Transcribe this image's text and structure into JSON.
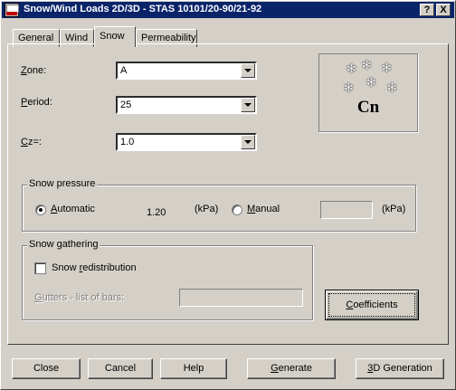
{
  "window": {
    "title": "Snow/Wind Loads 2D/3D - STAS 10101/20-90/21-92",
    "help_button": "?",
    "close_button": "X"
  },
  "tabs": [
    {
      "label": "General",
      "active": false
    },
    {
      "label": "Wind",
      "active": false
    },
    {
      "label": "Snow",
      "active": true
    },
    {
      "label": "Permeability",
      "active": false
    }
  ],
  "fields": {
    "zone": {
      "label_u": "Z",
      "label_rest": "one:",
      "value": "A"
    },
    "period": {
      "label_u": "P",
      "label_rest": "eriod:",
      "value": "25"
    },
    "cz": {
      "label_u": "C",
      "label_rest": "z=:",
      "value": "1.0"
    }
  },
  "cn_image": {
    "label": "Cn",
    "flake": "❄"
  },
  "snow_pressure": {
    "legend": "Snow pressure",
    "automatic_label_u": "A",
    "automatic_label_rest": "utomatic",
    "automatic_selected": true,
    "value": "1.20",
    "unit1": "(kPa)",
    "manual_label_u": "M",
    "manual_label_rest": "anual",
    "manual_selected": false,
    "manual_value": "",
    "unit2": "(kPa)"
  },
  "snow_gathering": {
    "legend": "Snow gathering",
    "redistribution_label_pre": "Snow ",
    "redistribution_label_u": "r",
    "redistribution_label_rest": "edistribution",
    "redistribution_checked": false,
    "gutters_label_u": "G",
    "gutters_label_rest": "utters - list of bars:",
    "gutters_value": ""
  },
  "buttons": {
    "coefficients_u": "C",
    "coefficients_rest": "oefficients",
    "close": "Close",
    "cancel": "Cancel",
    "help": "Help",
    "generate_u": "G",
    "generate_rest": "enerate",
    "generation_3d_u": "3",
    "generation_3d_rest": "D Generation"
  }
}
